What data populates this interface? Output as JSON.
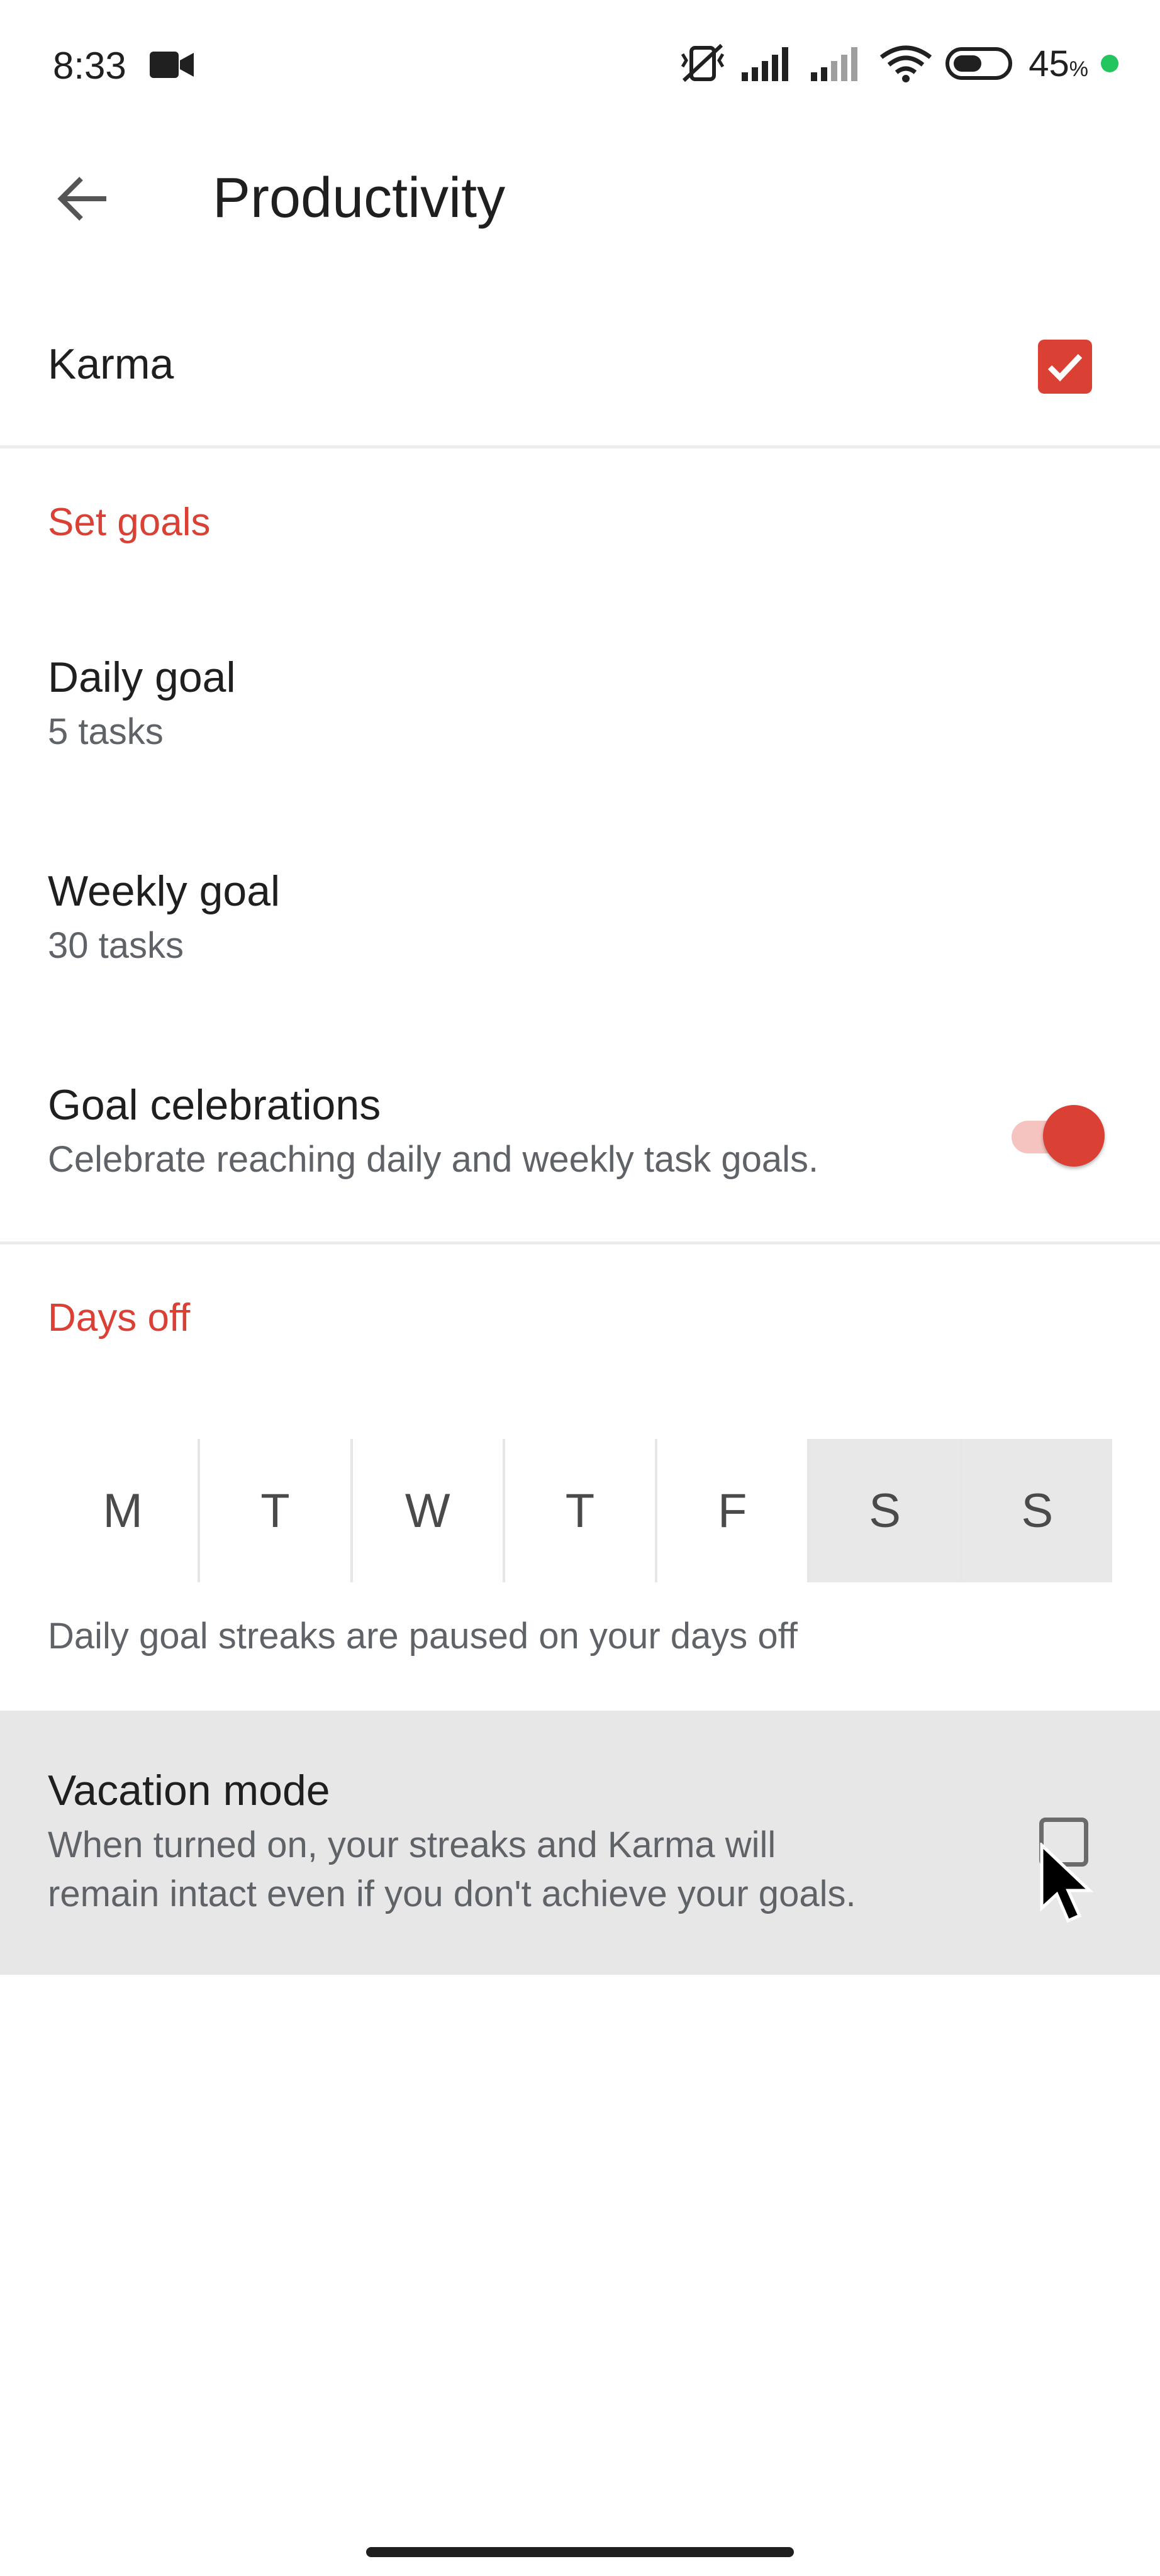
{
  "status_bar": {
    "time": "8:33",
    "battery_level": "45",
    "battery_unit": "%"
  },
  "app_bar": {
    "title": "Productivity"
  },
  "karma": {
    "label": "Karma",
    "checked": true
  },
  "set_goals": {
    "header": "Set goals",
    "daily_goal": {
      "title": "Daily goal",
      "value": "5 tasks"
    },
    "weekly_goal": {
      "title": "Weekly goal",
      "value": "30 tasks"
    },
    "goal_celebrations": {
      "title": "Goal celebrations",
      "subtitle": "Celebrate reaching daily and weekly task goals.",
      "enabled": true
    }
  },
  "days_off": {
    "header": "Days off",
    "days": [
      {
        "label": "M",
        "off": false
      },
      {
        "label": "T",
        "off": false
      },
      {
        "label": "W",
        "off": false
      },
      {
        "label": "T",
        "off": false
      },
      {
        "label": "F",
        "off": false
      },
      {
        "label": "S",
        "off": true
      },
      {
        "label": "S",
        "off": true
      }
    ],
    "note": "Daily goal streaks are paused on your days off"
  },
  "vacation_mode": {
    "title": "Vacation mode",
    "subtitle_line1": "When turned on, your streaks and Karma will",
    "subtitle_line2": "remain intact even if you don't achieve your goals.",
    "checked": false
  },
  "colors": {
    "accent": "#db4035",
    "divider": "#ececec",
    "selected_day_bg": "#e8e8e8"
  }
}
